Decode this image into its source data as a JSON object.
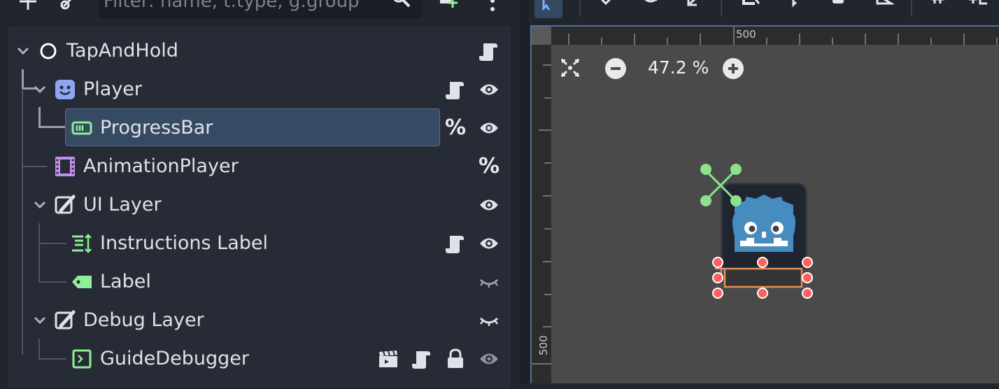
{
  "scene": {
    "filter_placeholder": "Filter: name, t:type, g:group",
    "nodes": [
      {
        "name": "TapAndHold"
      },
      {
        "name": "Player"
      },
      {
        "name": "ProgressBar"
      },
      {
        "name": "AnimationPlayer"
      },
      {
        "name": "UI Layer"
      },
      {
        "name": "Instructions Label"
      },
      {
        "name": "Label"
      },
      {
        "name": "Debug Layer"
      },
      {
        "name": "GuideDebugger"
      }
    ],
    "unique_name_marker": "%"
  },
  "viewport": {
    "zoom_label": "47.2 %",
    "ruler_h_label": "500",
    "ruler_v_label": "500"
  },
  "colors": {
    "selection_bg": "#374a63",
    "node_icon_green": "#8eef97",
    "node2d_blue": "#8da5f3",
    "animation_purple": "#c38ef1",
    "handle_red": "#ff5f5f",
    "godot_blue": "#478cbf"
  }
}
